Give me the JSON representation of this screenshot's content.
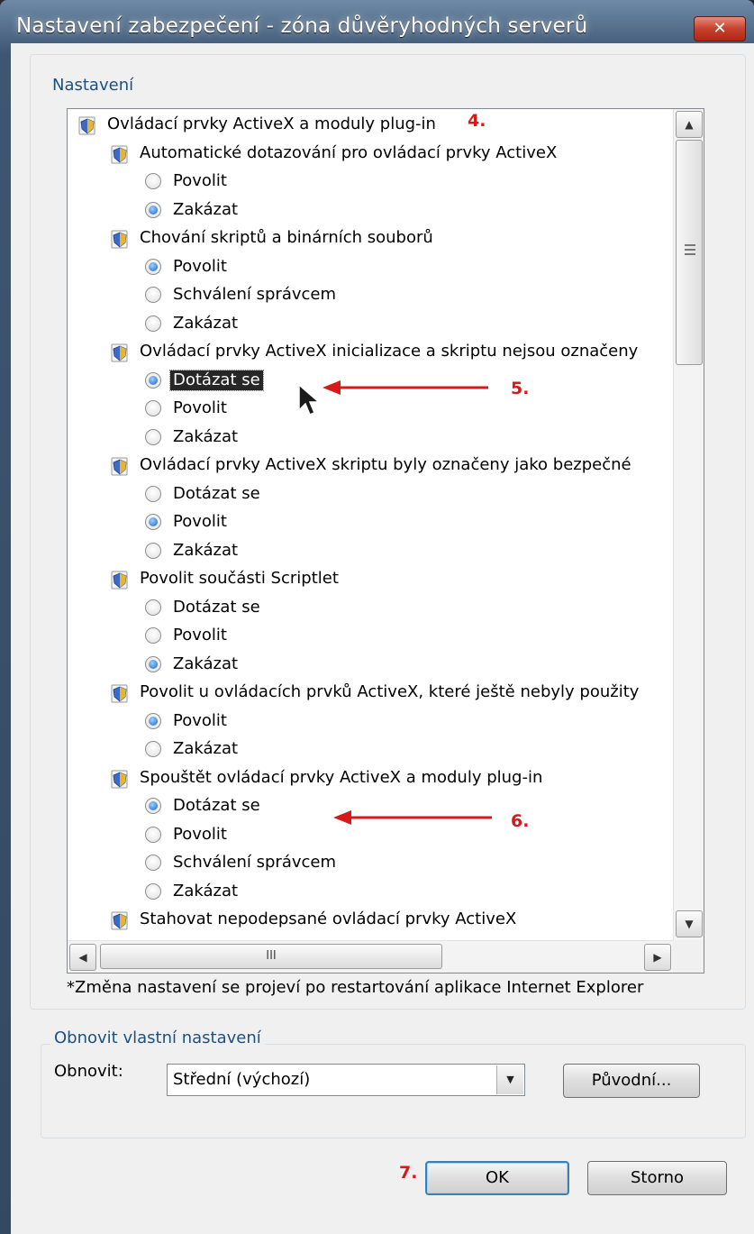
{
  "window": {
    "title": "Nastavení zabezpečení - zóna důvěryhodných serverů",
    "close_glyph": "✕"
  },
  "settings_group": {
    "label": "Nastavení",
    "tree": [
      {
        "type": "node",
        "level": 0,
        "label": "Ovládací prvky ActiveX a moduly plug-in"
      },
      {
        "type": "node",
        "level": 1,
        "label": "Automatické dotazování pro ovládací prvky ActiveX"
      },
      {
        "type": "option",
        "label": "Povolit",
        "checked": false
      },
      {
        "type": "option",
        "label": "Zakázat",
        "checked": true
      },
      {
        "type": "node",
        "level": 1,
        "label": "Chování skriptů a binárních souborů"
      },
      {
        "type": "option",
        "label": "Povolit",
        "checked": true
      },
      {
        "type": "option",
        "label": "Schválení správcem",
        "checked": false
      },
      {
        "type": "option",
        "label": "Zakázat",
        "checked": false
      },
      {
        "type": "node",
        "level": 1,
        "label": "Ovládací prvky ActiveX inicializace a skriptu nejsou označeny"
      },
      {
        "type": "option",
        "label": "Dotázat se",
        "checked": true,
        "selected": true
      },
      {
        "type": "option",
        "label": "Povolit",
        "checked": false
      },
      {
        "type": "option",
        "label": "Zakázat",
        "checked": false
      },
      {
        "type": "node",
        "level": 1,
        "label": "Ovládací prvky ActiveX skriptu byly označeny jako bezpečné"
      },
      {
        "type": "option",
        "label": "Dotázat se",
        "checked": false
      },
      {
        "type": "option",
        "label": "Povolit",
        "checked": true
      },
      {
        "type": "option",
        "label": "Zakázat",
        "checked": false
      },
      {
        "type": "node",
        "level": 1,
        "label": "Povolit součásti Scriptlet"
      },
      {
        "type": "option",
        "label": "Dotázat se",
        "checked": false
      },
      {
        "type": "option",
        "label": "Povolit",
        "checked": false
      },
      {
        "type": "option",
        "label": "Zakázat",
        "checked": true
      },
      {
        "type": "node",
        "level": 1,
        "label": "Povolit u ovládacích prvků ActiveX, které ještě nebyly použity"
      },
      {
        "type": "option",
        "label": "Povolit",
        "checked": true
      },
      {
        "type": "option",
        "label": "Zakázat",
        "checked": false
      },
      {
        "type": "node",
        "level": 1,
        "label": "Spouštět ovládací prvky ActiveX a moduly plug-in"
      },
      {
        "type": "option",
        "label": "Dotázat se",
        "checked": true
      },
      {
        "type": "option",
        "label": "Povolit",
        "checked": false
      },
      {
        "type": "option",
        "label": "Schválení správcem",
        "checked": false
      },
      {
        "type": "option",
        "label": "Zakázat",
        "checked": false
      },
      {
        "type": "node",
        "level": 1,
        "label": "Stahovat nepodepsané ovládací prvky ActiveX"
      }
    ],
    "hscroll_grip": "III",
    "note": "*Změna nastavení se projeví po restartování aplikace Internet Explorer"
  },
  "reset_group": {
    "label": "Obnovit vlastní nastavení",
    "reset_label": "Obnovit:",
    "combo_value": "Střední (výchozí)",
    "reset_button": "Původní..."
  },
  "buttons": {
    "ok": "OK",
    "cancel": "Storno"
  },
  "annotations": {
    "a4": "4.",
    "a5": "5.",
    "a6": "6.",
    "a7": "7."
  },
  "colors": {
    "annotation": "#d61a1a",
    "group_label": "#1c5180",
    "radio_on": "#1464c6"
  },
  "icons": {
    "tree_node": "shield-icon",
    "scroll_up": "scroll-up-icon",
    "scroll_down": "scroll-down-icon"
  }
}
